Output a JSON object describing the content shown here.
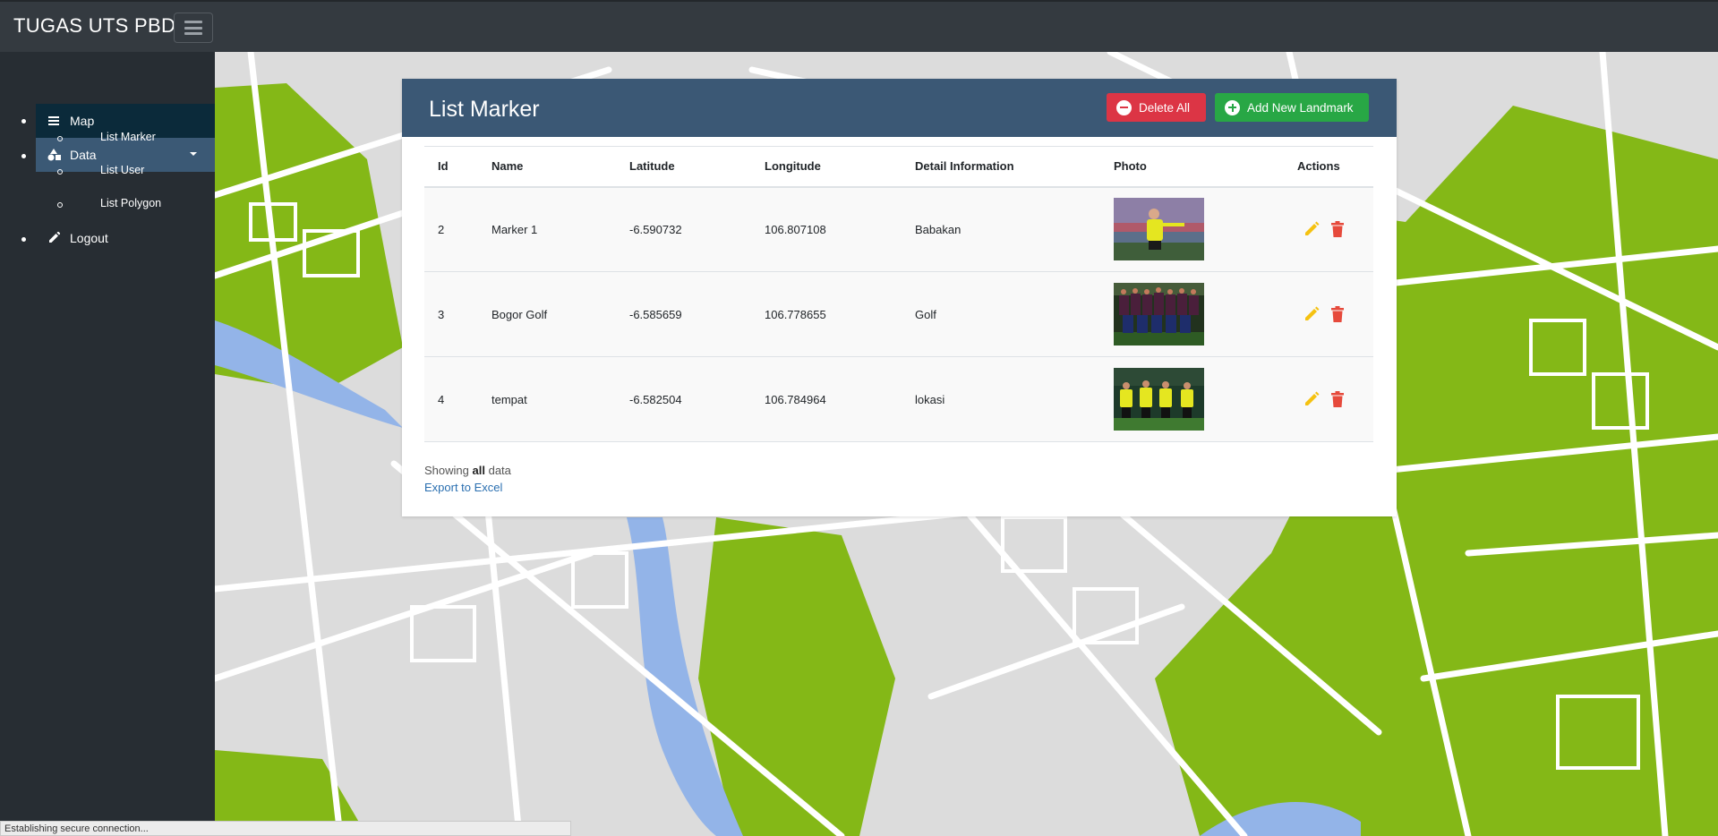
{
  "app": {
    "brand": "TUGAS UTS PBD"
  },
  "sidebar": {
    "items": [
      {
        "label": "Map",
        "icon": "list-icon"
      },
      {
        "label": "Data",
        "icon": "shapes-icon"
      },
      {
        "label": "Logout",
        "icon": "pencil-icon"
      }
    ],
    "subitems": [
      {
        "label": "List Marker"
      },
      {
        "label": "List User"
      },
      {
        "label": "List Polygon"
      }
    ]
  },
  "card": {
    "title": "List Marker",
    "delete_all_label": "Delete All",
    "add_label": "Add New Landmark"
  },
  "table": {
    "headers": [
      "Id",
      "Name",
      "Latitude",
      "Longitude",
      "Detail Information",
      "Photo",
      "Actions"
    ],
    "rows": [
      {
        "id": "2",
        "name": "Marker 1",
        "lat": "-6.590732",
        "lng": "106.807108",
        "info": "Babakan",
        "photo": "referee-photo"
      },
      {
        "id": "3",
        "name": "Bogor Golf",
        "lat": "-6.585659",
        "lng": "106.778655",
        "info": "Golf",
        "photo": "team-photo"
      },
      {
        "id": "4",
        "name": "tempat",
        "lat": "-6.582504",
        "lng": "106.784964",
        "info": "lokasi",
        "photo": "referees-photo"
      }
    ]
  },
  "footer": {
    "showing_prefix": "Showing",
    "showing_bold": "all",
    "showing_suffix": "data",
    "export_label": "Export to Excel"
  },
  "status": {
    "text": "Establishing secure connection..."
  },
  "colors": {
    "navbar": "#343a40",
    "sidebar": "#272d33",
    "active_item": "#3b5975",
    "card_header": "#3b5875",
    "danger": "#dc3545",
    "success": "#28a745",
    "edit_icon": "#f5c211",
    "delete_icon": "#e64a3c",
    "map_green": "#84b817",
    "map_water": "#93b4e8",
    "map_ground": "#dcdcdc"
  }
}
